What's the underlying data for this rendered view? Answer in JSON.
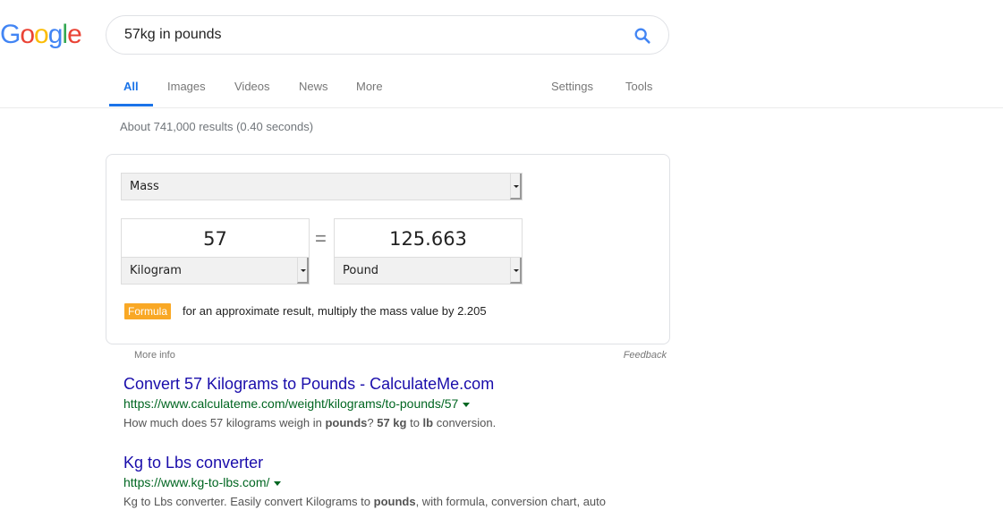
{
  "logo": {
    "letters": [
      "G",
      "o",
      "o",
      "g",
      "l",
      "e"
    ],
    "colors": [
      "#4285f4",
      "#ea4335",
      "#fbbc05",
      "#4285f4",
      "#34a853",
      "#ea4335"
    ]
  },
  "search": {
    "query": "57kg in pounds",
    "icon": "search-icon"
  },
  "tabs": {
    "items": [
      {
        "label": "All",
        "active": true
      },
      {
        "label": "Images"
      },
      {
        "label": "Videos"
      },
      {
        "label": "News"
      },
      {
        "label": "More"
      }
    ],
    "settings": "Settings",
    "tools": "Tools"
  },
  "result_stats": "About 741,000 results (0.40 seconds)",
  "converter": {
    "category": "Mass",
    "from_value": "57",
    "from_unit": "Kilogram",
    "equals": "=",
    "to_value": "125.663",
    "to_unit": "Pound",
    "formula_label": "Formula",
    "formula_text": "for an approximate result, multiply the mass value by 2.205",
    "more_info": "More info",
    "feedback": "Feedback",
    "accent_color": "#f9a825"
  },
  "results": [
    {
      "title": "Convert 57 Kilograms to Pounds - CalculateMe.com",
      "url": "https://www.calculateme.com/weight/kilograms/to-pounds/57",
      "snippet_parts": [
        {
          "text": "How much does 57 kilograms weigh in ",
          "bold": false
        },
        {
          "text": "pounds",
          "bold": true
        },
        {
          "text": "? ",
          "bold": false
        },
        {
          "text": "57 kg",
          "bold": true
        },
        {
          "text": " to ",
          "bold": false
        },
        {
          "text": "lb",
          "bold": true
        },
        {
          "text": " conversion.",
          "bold": false
        }
      ]
    },
    {
      "title": "Kg to Lbs converter",
      "url": "https://www.kg-to-lbs.com/",
      "snippet_parts": [
        {
          "text": "Kg to Lbs converter. Easily convert Kilograms to ",
          "bold": false
        },
        {
          "text": "pounds",
          "bold": true
        },
        {
          "text": ", with formula, conversion chart, auto",
          "bold": false
        }
      ]
    }
  ]
}
